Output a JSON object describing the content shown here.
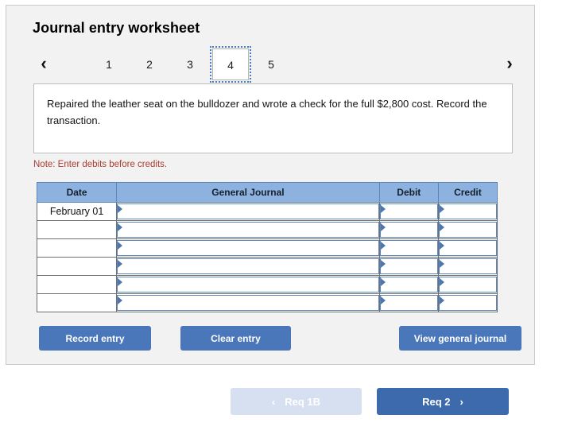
{
  "panel": {
    "title": "Journal entry worksheet"
  },
  "tabs": {
    "prev_icon": "chevron-left-icon",
    "next_icon": "chevron-right-icon",
    "prev_glyph": "‹",
    "next_glyph": "›",
    "items": [
      {
        "label": "1",
        "selected": false
      },
      {
        "label": "2",
        "selected": false
      },
      {
        "label": "3",
        "selected": false
      },
      {
        "label": "4",
        "selected": true
      },
      {
        "label": "5",
        "selected": false
      }
    ]
  },
  "instruction": {
    "text": "Repaired the leather seat on the bulldozer and wrote a check for the full $2,800 cost. Record the transaction."
  },
  "note": {
    "text": "Note: Enter debits before credits."
  },
  "table": {
    "headers": [
      "Date",
      "General Journal",
      "Debit",
      "Credit"
    ],
    "rows": [
      {
        "date": "February 01",
        "general_journal": "",
        "debit": "",
        "credit": ""
      },
      {
        "date": "",
        "general_journal": "",
        "debit": "",
        "credit": ""
      },
      {
        "date": "",
        "general_journal": "",
        "debit": "",
        "credit": ""
      },
      {
        "date": "",
        "general_journal": "",
        "debit": "",
        "credit": ""
      },
      {
        "date": "",
        "general_journal": "",
        "debit": "",
        "credit": ""
      },
      {
        "date": "",
        "general_journal": "",
        "debit": "",
        "credit": ""
      }
    ]
  },
  "actions": {
    "record_entry": "Record entry",
    "clear_entry": "Clear entry",
    "view_general_journal": "View general journal"
  },
  "req_nav": {
    "prev_label": "Req 1B",
    "next_label": "Req 2",
    "prev_glyph": "‹",
    "next_glyph": "›",
    "prev_enabled": false,
    "next_enabled": true
  },
  "colors": {
    "panel_bg": "#f2f2f2",
    "header_blue": "#8db2e0",
    "button_blue": "#4a76ba",
    "req_next_blue": "#3c6aad",
    "req_prev_disabled": "#d6e0f0",
    "note_red": "#b03a2e",
    "field_border_blue": "#5d85b8"
  }
}
